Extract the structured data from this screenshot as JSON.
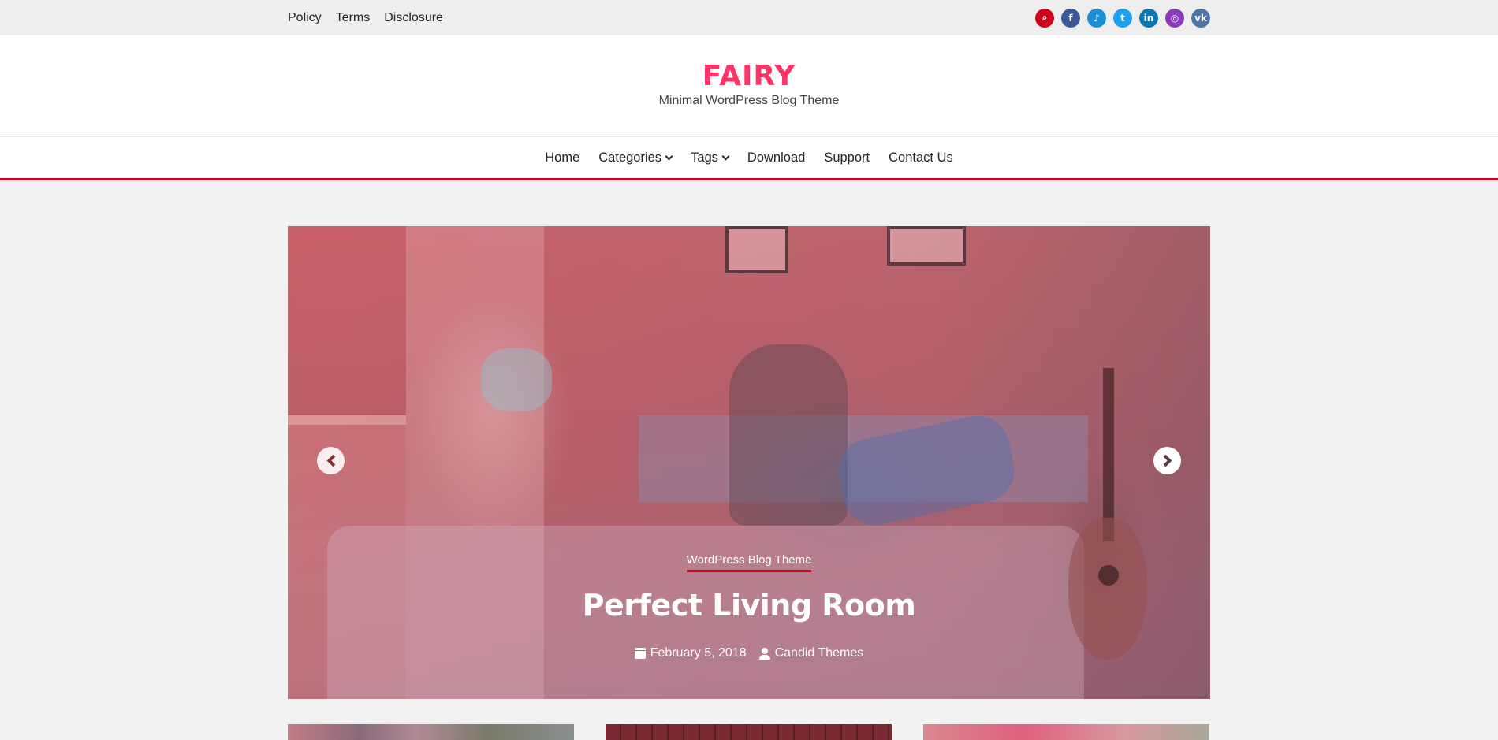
{
  "topbar": {
    "links": [
      "Policy",
      "Terms",
      "Disclosure"
    ],
    "social": [
      {
        "name": "search-icon",
        "glyph": "⌕",
        "color": "#d0021b"
      },
      {
        "name": "facebook-icon",
        "glyph": "f",
        "color": "#3b5998"
      },
      {
        "name": "tiktok-icon",
        "glyph": "♪",
        "color": "#1a8fd6"
      },
      {
        "name": "twitter-icon",
        "glyph": "t",
        "color": "#1da1f2"
      },
      {
        "name": "linkedin-icon",
        "glyph": "in",
        "color": "#0a77b5"
      },
      {
        "name": "instagram-icon",
        "glyph": "◎",
        "color": "#8a3ab9"
      },
      {
        "name": "vk-icon",
        "glyph": "vk",
        "color": "#4a76a8"
      }
    ]
  },
  "branding": {
    "title": "FAIRY",
    "tagline": "Minimal WordPress Blog Theme",
    "accent": "#ff3366"
  },
  "nav": {
    "items": [
      {
        "label": "Home",
        "dropdown": false
      },
      {
        "label": "Categories",
        "dropdown": true
      },
      {
        "label": "Tags",
        "dropdown": true
      },
      {
        "label": "Download",
        "dropdown": false
      },
      {
        "label": "Support",
        "dropdown": false
      },
      {
        "label": "Contact Us",
        "dropdown": false
      }
    ],
    "border_color": "#d0021b"
  },
  "slider": {
    "category": "WordPress Blog Theme",
    "title": "Perfect Living Room",
    "date": "February 5, 2018",
    "author": "Candid Themes"
  }
}
